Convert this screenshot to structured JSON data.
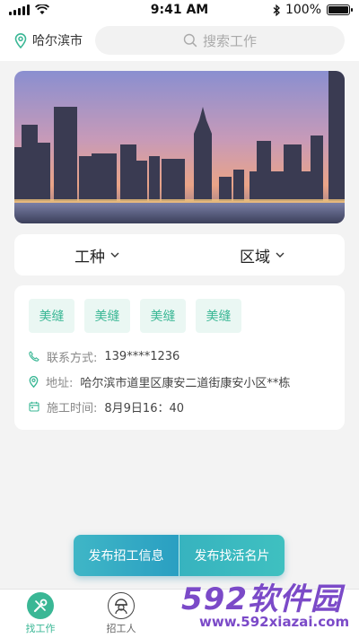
{
  "status_bar": {
    "carrier": "",
    "time": "9:41 AM",
    "battery": "100%",
    "battery_level": 1.0
  },
  "header": {
    "city": "哈尔滨市",
    "search_placeholder": "搜索工作"
  },
  "filters": [
    {
      "label": "工种"
    },
    {
      "label": "区域"
    }
  ],
  "job_card": {
    "tags": [
      "美缝",
      "美缝",
      "美缝",
      "美缝"
    ],
    "contact_label": "联系方式:",
    "contact_value": "139****1236",
    "address_label": "地址:",
    "address_value": "哈尔滨市道里区康安二道街康安小区**栋",
    "time_label": "施工时间:",
    "time_value": "8月9日16：40"
  },
  "actions": {
    "post_job": "发布招工信息",
    "post_card": "发布找活名片"
  },
  "tabbar": {
    "items": [
      {
        "label": "找工作",
        "active": true
      },
      {
        "label": "招工人",
        "active": false
      }
    ]
  },
  "watermark": {
    "logo": "592软件园",
    "url": "www.592xiazai.com"
  },
  "colors": {
    "accent": "#3ab795",
    "button": "#2fa8c4",
    "background": "#f3f3f3"
  }
}
